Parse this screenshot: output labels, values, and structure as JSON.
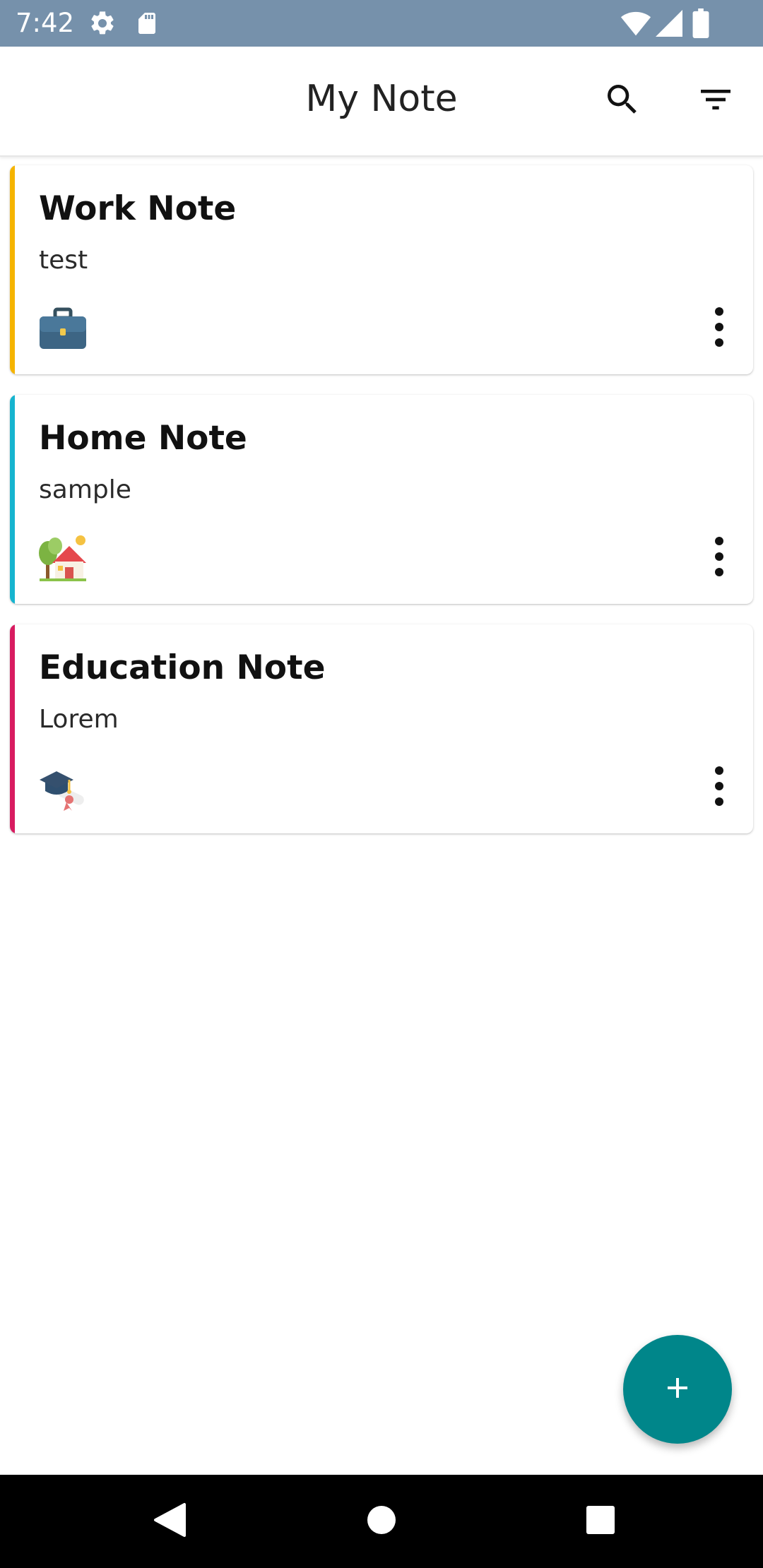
{
  "status_bar": {
    "time": "7:42",
    "left_icons": [
      "gear-icon",
      "sd-card-icon"
    ],
    "right_icons": [
      "wifi-icon",
      "signal-icon",
      "battery-icon"
    ],
    "background": "#7691ab"
  },
  "app_bar": {
    "title": "My Note",
    "actions": [
      "search-icon",
      "filter-icon"
    ]
  },
  "notes": [
    {
      "title": "Work Note",
      "body": "test",
      "category_icon": "briefcase-icon",
      "accent": "#f5b400"
    },
    {
      "title": "Home Note",
      "body": "sample",
      "category_icon": "house-icon",
      "accent": "#16b4cf"
    },
    {
      "title": "Education Note",
      "body": "Lorem",
      "category_icon": "graduation-cap-icon",
      "accent": "#d81b60"
    }
  ],
  "fab": {
    "icon": "plus-icon",
    "color": "#00868a"
  },
  "nav_bar": {
    "buttons": [
      "back-icon",
      "home-icon",
      "recents-icon"
    ]
  }
}
